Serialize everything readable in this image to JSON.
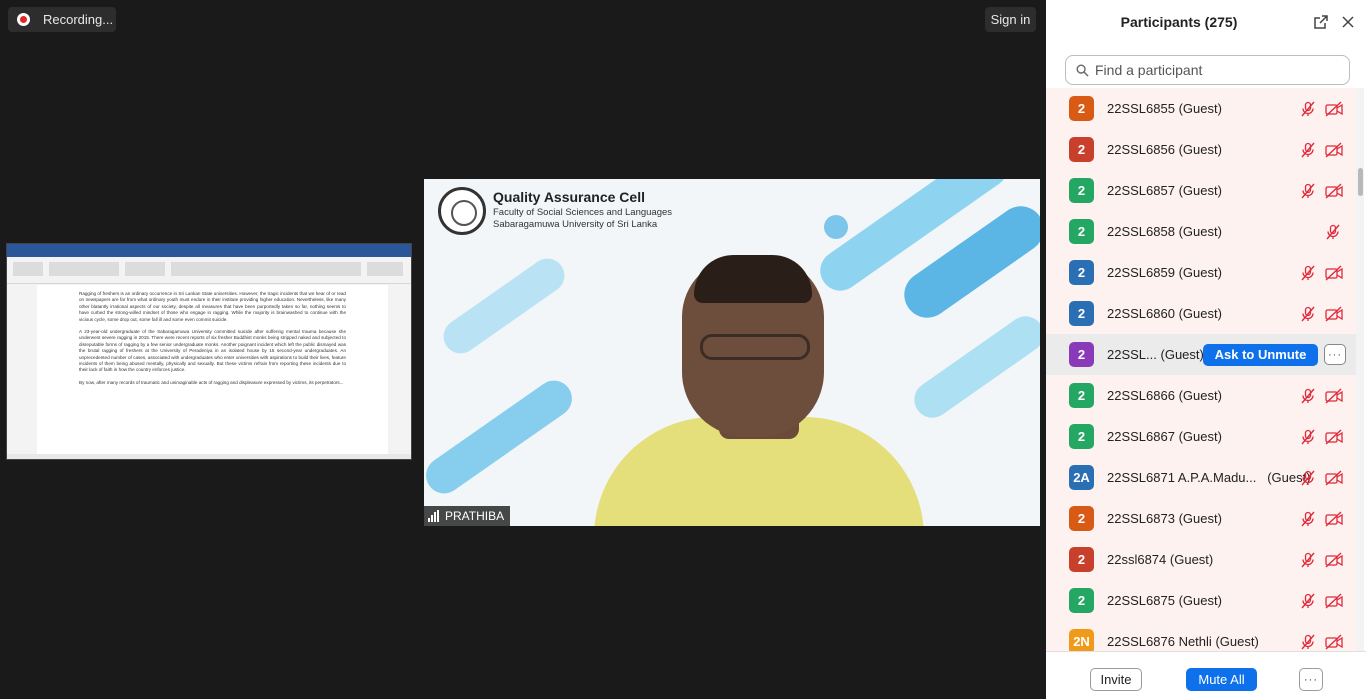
{
  "top_bar": {
    "recording_label": "Recording...",
    "sign_in_label": "Sign in"
  },
  "shared_screen": {
    "paragraphs": [
      "Ragging of freshers is an ordinary occurrence in Sri Lankan State universities. However, the tragic incidents that we hear of or read on newspapers are far from what ordinary youth must endure in their institute providing higher education. Nevertheless, like many other blatantly irrational aspects of our society, despite all measures that have been purportedly taken so far, nothing seems to have curbed the strong-willed mindset of those who engage in ragging. While the majority is brainwashed to continue with the vicious cycle, some drop out, some fall ill and some even commit suicide.",
      "A 23-year-old undergraduate of the Sabaragamuwa University committed suicide after suffering mental trauma because she underwent severe ragging in 2015. There were recent reports of six fresher Buddhist monks being stripped naked and subjected to disreputable forms of ragging by a few senior undergraduate monks. Another poignant incident which left the public dismayed was the brutal ragging of freshers at the University of Peradeniya in an isolated house by 15 second-year undergraduates. An unprecedented number of cases, associated with undergraduates who enter universities with aspirations to build their lives, feature incidents of them being abused mentally, physically and sexually. But these victims refrain from reporting these incidents due to their lack of faith in how the country enforces justice.",
      "By now, after many records of traumatic and unimaginable acts of ragging and displeasure expressed by victims, its perpetrators..."
    ]
  },
  "video": {
    "org_title": "Quality Assurance Cell",
    "org_line1": "Faculty of Social Sciences and Languages",
    "org_line2": "Sabaragamuwa University of Sri Lanka",
    "speaker_name": "PRATHIBA"
  },
  "panel": {
    "title": "Participants (275)",
    "search_placeholder": "Find a participant",
    "participants": [
      {
        "avatar": "2",
        "color": "#d85a14",
        "name": "22SSL6855",
        "guest": "(Guest)"
      },
      {
        "avatar": "2",
        "color": "#c8402c",
        "name": "22SSL6856",
        "guest": "(Guest)"
      },
      {
        "avatar": "2",
        "color": "#25a764",
        "name": "22SSL6857",
        "guest": "(Guest)"
      },
      {
        "avatar": "2",
        "color": "#25a764",
        "name": "22SSL6858",
        "guest": "(Guest)"
      },
      {
        "avatar": "2",
        "color": "#2a6fb3",
        "name": "22SSL6859",
        "guest": "(Guest)"
      },
      {
        "avatar": "2",
        "color": "#2a6fb3",
        "name": "22SSL6860",
        "guest": "(Guest)"
      },
      {
        "avatar": "2",
        "color": "#8a3ab9",
        "name": "22SSL...",
        "guest": "(Guest)"
      },
      {
        "avatar": "2",
        "color": "#25a764",
        "name": "22SSL6866",
        "guest": "(Guest)"
      },
      {
        "avatar": "2",
        "color": "#25a764",
        "name": "22SSL6867",
        "guest": "(Guest)"
      },
      {
        "avatar": "2A",
        "color": "#2a6fb3",
        "name": "22SSL6871 A.P.A.Madu...",
        "guest": "(Guest)"
      },
      {
        "avatar": "2",
        "color": "#d85a14",
        "name": "22SSL6873",
        "guest": "(Guest)"
      },
      {
        "avatar": "2",
        "color": "#c8402c",
        "name": "22ssl6874",
        "guest": "(Guest)"
      },
      {
        "avatar": "2",
        "color": "#25a764",
        "name": "22SSL6875",
        "guest": "(Guest)"
      },
      {
        "avatar": "2N",
        "color": "#f09a1a",
        "name": "22SSL6876 Nethli",
        "guest": "(Guest)"
      }
    ],
    "ask_to_unmute_label": "Ask to Unmute",
    "more_label": "···",
    "invite_label": "Invite",
    "mute_all_label": "Mute All",
    "footer_more_label": "···"
  },
  "colors": {
    "accent": "#0e71eb",
    "muted_icon": "#e0293b"
  }
}
